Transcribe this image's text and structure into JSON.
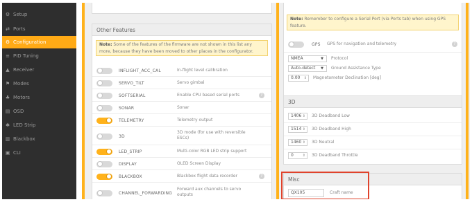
{
  "sidebar": {
    "items": [
      {
        "label": "Setup",
        "icon": "wrench-icon",
        "glyph": "⚙",
        "active": false
      },
      {
        "label": "Ports",
        "icon": "plug-icon",
        "glyph": "⇄",
        "active": false
      },
      {
        "label": "Configuration",
        "icon": "gear-icon",
        "glyph": "⚙",
        "active": true
      },
      {
        "label": "PID Tuning",
        "icon": "sliders-icon",
        "glyph": "≡",
        "active": false
      },
      {
        "label": "Receiver",
        "icon": "antenna-icon",
        "glyph": "▲",
        "active": false
      },
      {
        "label": "Modes",
        "icon": "flag-icon",
        "glyph": "⚑",
        "active": false
      },
      {
        "label": "Motors",
        "icon": "motor-icon",
        "glyph": "♣",
        "active": false
      },
      {
        "label": "OSD",
        "icon": "display-icon",
        "glyph": "▤",
        "active": false
      },
      {
        "label": "LED Strip",
        "icon": "led-icon",
        "glyph": "✱",
        "active": false
      },
      {
        "label": "Blackbox",
        "icon": "blackbox-icon",
        "glyph": "▥",
        "active": false
      },
      {
        "label": "CLI",
        "icon": "terminal-icon",
        "glyph": "▣",
        "active": false
      }
    ]
  },
  "other_features": {
    "title": "Other Features",
    "note_bold": "Note:",
    "note_text": "Some of the features of the firmware are not shown in this list any more, because they have been moved to other places in the configurator.",
    "features": [
      {
        "name": "INFLIGHT_ACC_CAL",
        "desc": "In-flight level calibration",
        "on": false,
        "help": false
      },
      {
        "name": "SERVO_TILT",
        "desc": "Servo gimbal",
        "on": false,
        "help": false
      },
      {
        "name": "SOFTSERIAL",
        "desc": "Enable CPU based serial ports",
        "on": false,
        "help": true
      },
      {
        "name": "SONAR",
        "desc": "Sonar",
        "on": false,
        "help": false
      },
      {
        "name": "TELEMETRY",
        "desc": "Telemetry output",
        "on": true,
        "help": false
      },
      {
        "name": "3D",
        "desc": "3D mode (for use with reversible ESCs)",
        "on": false,
        "help": false
      },
      {
        "name": "LED_STRIP",
        "desc": "Multi-color RGB LED strip support",
        "on": true,
        "help": false
      },
      {
        "name": "DISPLAY",
        "desc": "OLED Screen Display",
        "on": false,
        "help": false
      },
      {
        "name": "BLACKBOX",
        "desc": "Blackbox flight data recorder",
        "on": true,
        "help": true
      },
      {
        "name": "CHANNEL_FORWARDING",
        "desc": "Forward aux channels to servo outputs",
        "on": false,
        "help": false
      }
    ]
  },
  "gps": {
    "note_bold": "Note:",
    "note_text": "Remember to configure a Serial Port (via Ports tab) when using GPS feature.",
    "toggle_label": "GPS",
    "toggle_desc": "GPS for navigation and telemetry",
    "toggle_on": false,
    "protocol_value": "NMEA",
    "protocol_label": "Protocol",
    "ground_value": "Auto-detect",
    "ground_label": "Ground Assistance Type",
    "declination_value": "0.00",
    "declination_label": "Magnetometer Declination [deg]"
  },
  "three_d": {
    "title": "3D",
    "fields": [
      {
        "value": "1406",
        "label": "3D Deadband Low"
      },
      {
        "value": "1514",
        "label": "3D Deadband High"
      },
      {
        "value": "1460",
        "label": "3D Neutral"
      },
      {
        "value": "0",
        "label": "3D Deadband Throttle"
      }
    ]
  },
  "misc": {
    "title": "Misc",
    "craft_name_value": "QX105",
    "craft_name_label": "Craft name"
  },
  "colors": {
    "accent": "#ffb21b",
    "sidebar_bg": "#2e2e2e",
    "highlight": "#e0432c"
  }
}
